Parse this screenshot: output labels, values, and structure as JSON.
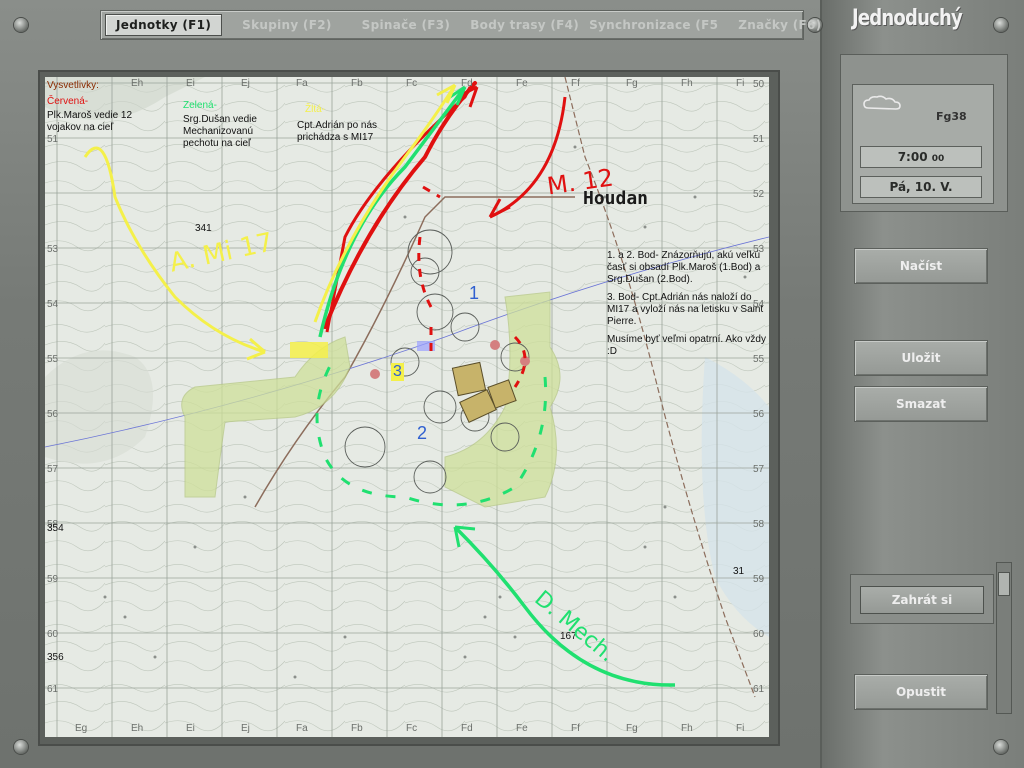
{
  "tabs": [
    {
      "label": "Jednotky  (F1)",
      "active": true
    },
    {
      "label": "Skupiny  (F2)",
      "active": false
    },
    {
      "label": "Spinače  (F3)",
      "active": false
    },
    {
      "label": "Body  trasy  (F4)",
      "active": false
    },
    {
      "label": "Synchronizace  (F5",
      "active": false
    },
    {
      "label": "Značky  (F6)",
      "active": false
    }
  ],
  "app_title": "Jednoduchý",
  "info": {
    "place": "Fg38",
    "time": "7:00",
    "time_seconds": "00",
    "date": "Pá,  10. V."
  },
  "buttons": {
    "load": "Načíst",
    "save": "Uložit",
    "delete": "Smazat",
    "play": "Zahrát  si",
    "exit": "Opustit"
  },
  "map": {
    "grid_cols_top": [
      "Eh",
      "Ei",
      "Ej",
      "Fa",
      "Fb",
      "Fc",
      "Fd",
      "Fe",
      "Ff",
      "Fg",
      "Fh",
      "Fi"
    ],
    "grid_cols_bottom": [
      "Eg",
      "Eh",
      "Ei",
      "Ej",
      "Fa",
      "Fb",
      "Fc",
      "Fd",
      "Fe",
      "Ff",
      "Fg",
      "Fh",
      "Fi"
    ],
    "grid_rows": [
      "50",
      "51",
      "52",
      "53",
      "54",
      "55",
      "56",
      "57",
      "58",
      "59",
      "60",
      "61"
    ],
    "elevations": [
      "341",
      "354",
      "356",
      "167",
      "31"
    ],
    "town_name": "Houdan",
    "legend": {
      "title": "Vysvetlivky:",
      "red_label": "Červená-",
      "red_text": "Plk.Maroš vedie 12 vojakov na cieľ",
      "green_label": "Zelená-",
      "green_text": "Srg.Dušan vedie Mechanizovanú pechotu na cieľ",
      "yellow_label": "Žltá-",
      "yellow_text": "Cpt.Adrián po nás prichádza s MI17"
    },
    "notes": [
      "1. a 2. Bod- Znázorňujú, akú veľkú časť si obsadí Plk.Maroš (1.Bod) a Srg.Dušan (2.Bod).",
      "3. Bod- Cpt.Adrián nás naloží do MI17 a vyloží nás na letisku v Saint Pierre.",
      "Musíme byť veľmi opatrní. Ako vždy :D"
    ],
    "handwritten": {
      "red": "M. 12",
      "yellow": "A. Mi 17",
      "green": "D. Mech.",
      "point1": "1",
      "point2": "2",
      "point3": "3"
    },
    "colors": {
      "red": "#e01010",
      "green": "#20e070",
      "yellow": "#f4f04a",
      "zone": "#c9dd8a"
    }
  }
}
